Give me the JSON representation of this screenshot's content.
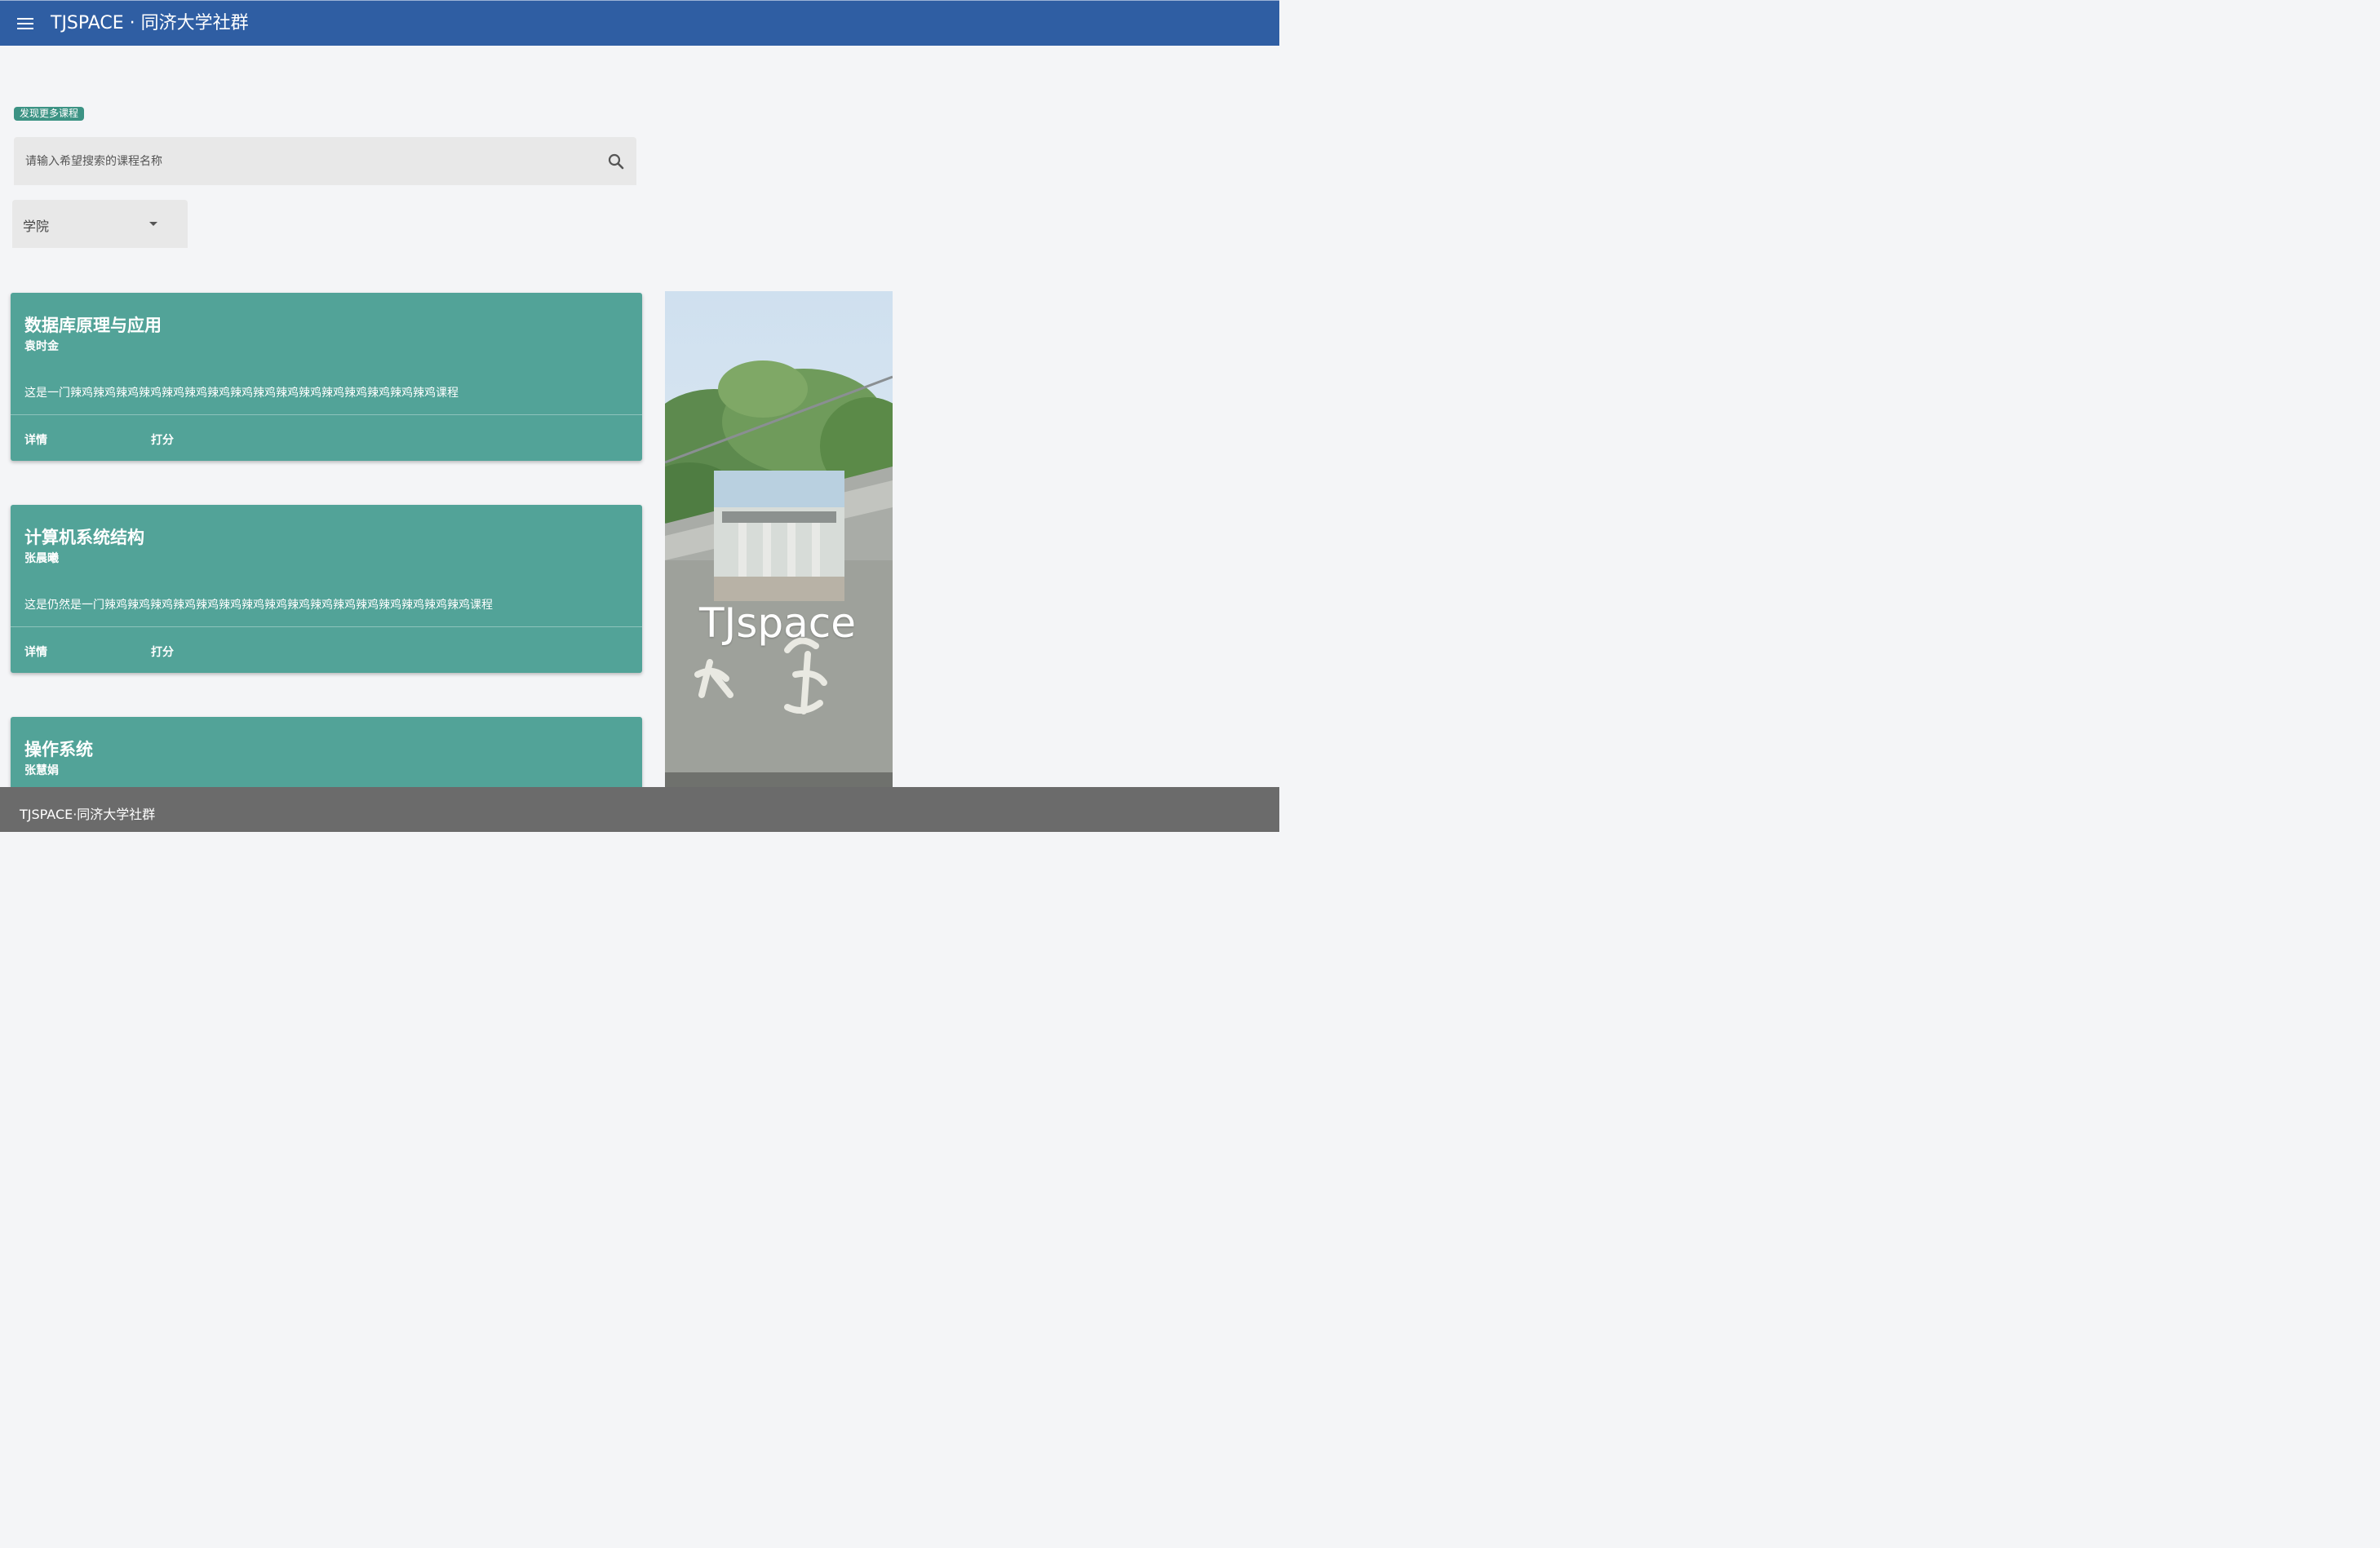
{
  "app_bar": {
    "title": "TJSPACE · 同济大学社群"
  },
  "discover_chip": "发现更多课程",
  "search": {
    "placeholder": "请输入希望搜索的课程名称",
    "value": ""
  },
  "filter": {
    "selected": "学院"
  },
  "courses": [
    {
      "title": "数据库原理与应用",
      "teacher": "袁时金",
      "description": "这是一门辣鸡辣鸡辣鸡辣鸡辣鸡辣鸡辣鸡辣鸡辣鸡辣鸡辣鸡辣鸡辣鸡辣鸡辣鸡辣鸡课程",
      "details_label": "详情",
      "rate_label": "打分"
    },
    {
      "title": "计算机系统结构",
      "teacher": "张晨曦",
      "description": "这是仍然是一门辣鸡辣鸡辣鸡辣鸡辣鸡辣鸡辣鸡辣鸡辣鸡辣鸡辣鸡辣鸡辣鸡辣鸡辣鸡辣鸡课程",
      "details_label": "详情",
      "rate_label": "打分"
    },
    {
      "title": "操作系统",
      "teacher": "张慧娟"
    }
  ],
  "promo": {
    "logo_text": "TJspace"
  },
  "footer": {
    "text": "TJSPACE·同济大学社群"
  },
  "colors": {
    "app_bar": "#2f5ea3",
    "card": "#52a398",
    "chip": "#3c9384",
    "footer": "#6b6b6b",
    "page_bg": "#f4f5f7"
  },
  "icons": {
    "menu": "menu-icon",
    "search": "search-icon",
    "dropdown": "chevron-down-icon"
  }
}
